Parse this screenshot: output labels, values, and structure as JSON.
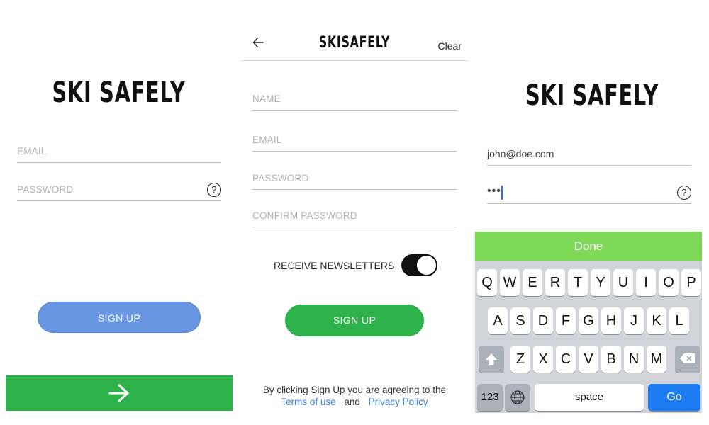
{
  "screen_login": {
    "logo": "SKI SAFELY",
    "email_placeholder": "EMAIL",
    "password_placeholder": "PASSWORD",
    "help_glyph": "?",
    "signup_label": "SIGN UP",
    "signup_color": "#6a97e2",
    "next_bar_color": "#2db24a",
    "next_icon": "arrow-right-icon"
  },
  "screen_signup": {
    "logo": "SKISAFELY",
    "clear_label": "Clear",
    "back_icon": "arrow-left-icon",
    "name_placeholder": "NAME",
    "email_placeholder": "EMAIL",
    "password_placeholder": "PASSWORD",
    "confirm_placeholder": "CONFIRM PASSWORD",
    "newsletter_label": "RECEIVE NEWSLETTERS",
    "newsletter_on": true,
    "signup_label": "SIGN UP",
    "signup_color": "#2db24a",
    "legal_text": "By clicking Sign Up you are agreeing to the",
    "terms_label": "Terms of use",
    "and_label": "and",
    "privacy_label": "Privacy Policy",
    "link_color": "#3a7bd5"
  },
  "screen_keyboard": {
    "logo": "SKI SAFELY",
    "email_value": "john@doe.com",
    "password_value": "•••",
    "help_glyph": "?",
    "done_label": "Done",
    "done_color": "#7ed957",
    "row1": [
      "Q",
      "W",
      "E",
      "R",
      "T",
      "Y",
      "U",
      "I",
      "O",
      "P"
    ],
    "row2": [
      "A",
      "S",
      "D",
      "F",
      "G",
      "H",
      "J",
      "K",
      "L"
    ],
    "row3": [
      "Z",
      "X",
      "C",
      "V",
      "B",
      "N",
      "M"
    ],
    "num_label": "123",
    "space_label": "space",
    "go_label": "Go",
    "go_color": "#1e7cf2"
  }
}
